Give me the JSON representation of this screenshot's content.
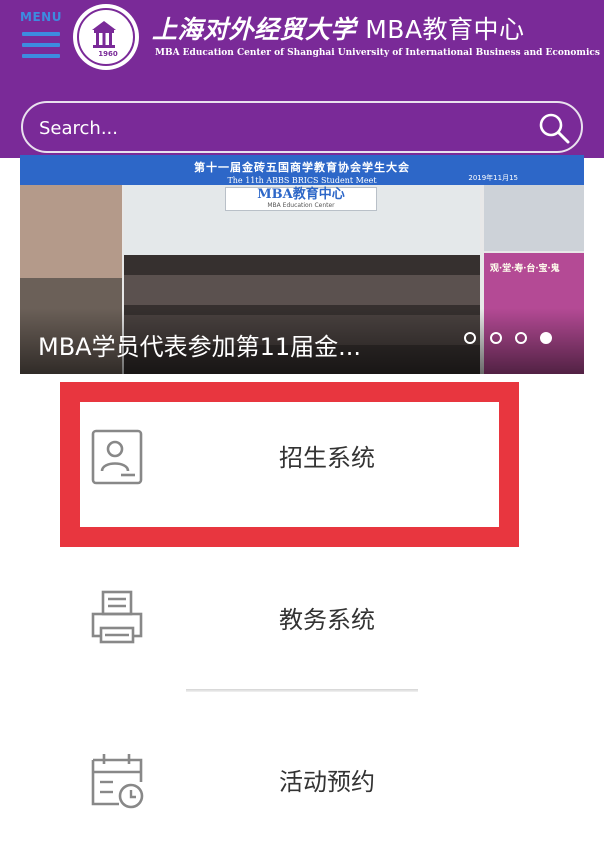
{
  "header": {
    "menu_label": "MENU",
    "title_cn": "上海对外经贸大学",
    "title_cn_mba": "MBA教育中心",
    "title_en": "MBA Education Center of Shanghai University of International Business and Economics",
    "logo_year": "1960",
    "background_color": "#7a2a98"
  },
  "search": {
    "placeholder": "Search...",
    "value": "",
    "icon": "search-icon"
  },
  "banner": {
    "top_title_cn": "第十一届金砖五国商学教育协会学生大会",
    "top_title_en": "The 11th ABBS BRICS Student Meet",
    "top_date": "2019年11月15",
    "sign_main": "MBA教育中心",
    "sign_sub": "MBA Education Center",
    "side_text": "观·堂·寿·台·宝·鬼",
    "caption": "MBA学员代表参加第11届金...",
    "slide_count": 4,
    "active_slide": 4
  },
  "menu_items": [
    {
      "label": "招生系统",
      "icon": "id-card-icon",
      "highlighted": true
    },
    {
      "label": "教务系统",
      "icon": "printer-icon",
      "highlighted": false
    },
    {
      "label": "活动预约",
      "icon": "calendar-clock-icon",
      "highlighted": false
    }
  ],
  "colors": {
    "accent_purple": "#7a2a98",
    "highlight_red": "#e8363f",
    "menu_blue": "#3d8be0"
  }
}
